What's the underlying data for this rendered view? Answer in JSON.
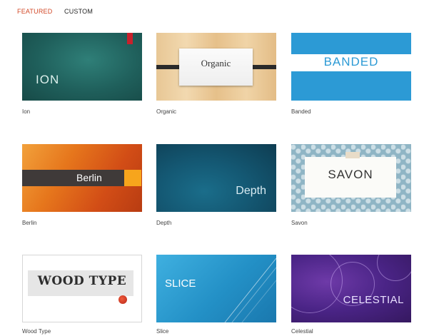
{
  "tabs": {
    "featured": "FEATURED",
    "custom": "CUSTOM"
  },
  "themes": [
    {
      "name": "Ion",
      "thumb_text": "ION"
    },
    {
      "name": "Organic",
      "thumb_text": "Organic"
    },
    {
      "name": "Banded",
      "thumb_text": "BANDED"
    },
    {
      "name": "Berlin",
      "thumb_text": "Berlin"
    },
    {
      "name": "Depth",
      "thumb_text": "Depth"
    },
    {
      "name": "Savon",
      "thumb_text": "SAVON"
    },
    {
      "name": "Wood Type",
      "thumb_text": "WOOD TYPE"
    },
    {
      "name": "Slice",
      "thumb_text": "SLICE"
    },
    {
      "name": "Celestial",
      "thumb_text": "CELESTIAL"
    }
  ],
  "colors": {
    "active_tab": "#d24726",
    "ion": "#1f5f5b",
    "banded": "#2c9ad5",
    "berlin": "#e6761c",
    "depth": "#145873",
    "slice": "#2390c6",
    "celestial": "#4a2486"
  }
}
